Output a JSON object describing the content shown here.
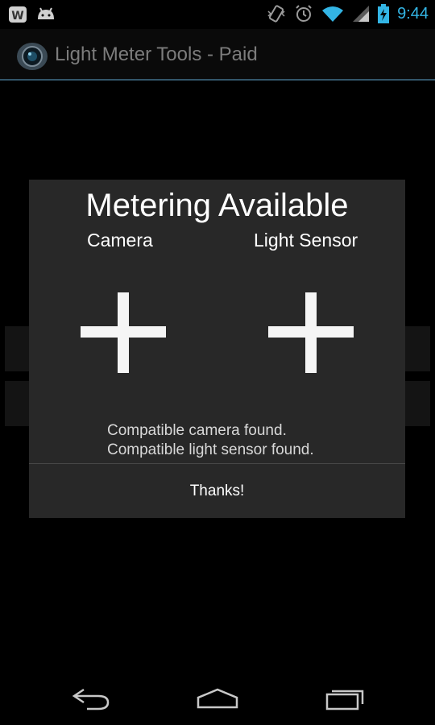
{
  "status_bar": {
    "time": "9:44",
    "left_icons": [
      "w-app-notification-icon",
      "android-notification-icon"
    ],
    "right_icons": [
      "vibrate-icon",
      "alarm-icon",
      "wifi-icon",
      "signal-icon",
      "battery-charging-icon"
    ],
    "accent_color": "#33b5e5"
  },
  "action_bar": {
    "title": "Light Meter Tools - Paid",
    "icon": "camera-lens-icon"
  },
  "dialog": {
    "title": "Metering Available",
    "columns": [
      {
        "label": "Camera",
        "icon": "plus-icon"
      },
      {
        "label": "Light Sensor",
        "icon": "plus-icon"
      }
    ],
    "messages": [
      "Compatible camera found.",
      "Compatible light sensor found."
    ],
    "button_label": "Thanks!"
  },
  "nav_bar": {
    "buttons": [
      "back-icon",
      "home-icon",
      "recent-apps-icon"
    ]
  }
}
